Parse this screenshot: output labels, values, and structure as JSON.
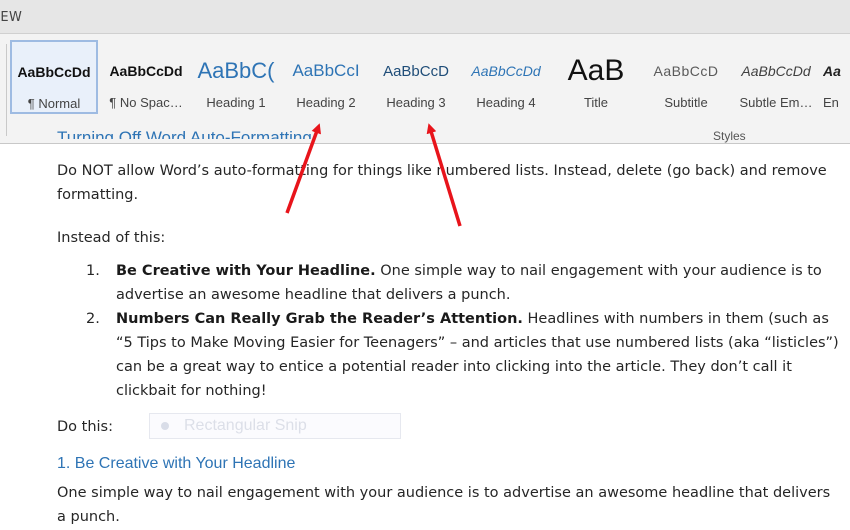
{
  "ribbon": {
    "tab_fragment": "IEW",
    "group_label": "Styles",
    "styles": [
      {
        "preview": "AaBbCcDd",
        "name": "¶ Normal",
        "selected": true
      },
      {
        "preview": "AaBbCcDd",
        "name": "¶ No Spac…"
      },
      {
        "preview": "AaBbC(",
        "name": "Heading 1"
      },
      {
        "preview": "AaBbCcI",
        "name": "Heading 2"
      },
      {
        "preview": "AaBbCcD",
        "name": "Heading 3"
      },
      {
        "preview": "AaBbCcDd",
        "name": "Heading 4"
      },
      {
        "preview": "AaB",
        "name": "Title"
      },
      {
        "preview": "AaBbCcD",
        "name": "Subtitle"
      },
      {
        "preview": "AaBbCcDd",
        "name": "Subtle Em…"
      },
      {
        "preview": "Aa",
        "name": "En"
      }
    ]
  },
  "document": {
    "cut_heading": "Turning Off Word Auto-Formatting",
    "intro": "Do NOT allow Word’s auto-formatting for things like numbered lists. Instead, delete (go back) and remove formatting.",
    "instead": "Instead of this:",
    "list": [
      {
        "num": "1.",
        "bold": "Be Creative with Your Headline.",
        "text": " One simple way to nail engagement with your audience is to advertise an awesome headline that delivers a punch."
      },
      {
        "num": "2.",
        "bold": "Numbers Can Really Grab the Reader’s Attention.",
        "text": " Headlines with numbers in them (such as “5 Tips to Make Moving Easier for Teenagers” – and articles that use numbered lists (aka “listicles”) can be a great way to entice a potential reader into clicking into the article. They don’t call it clickbait for nothing!"
      }
    ],
    "do_this": "Do this:",
    "snip_label": "Rectangular Snip",
    "heading": "1. Be Creative with Your Headline",
    "body": "One simple way to nail engagement with your audience is to advertise an awesome headline that delivers a punch."
  },
  "colors": {
    "heading_blue": "#2e74b5",
    "arrow_red": "#e8141b",
    "selected_border": "#9ebbe2"
  }
}
